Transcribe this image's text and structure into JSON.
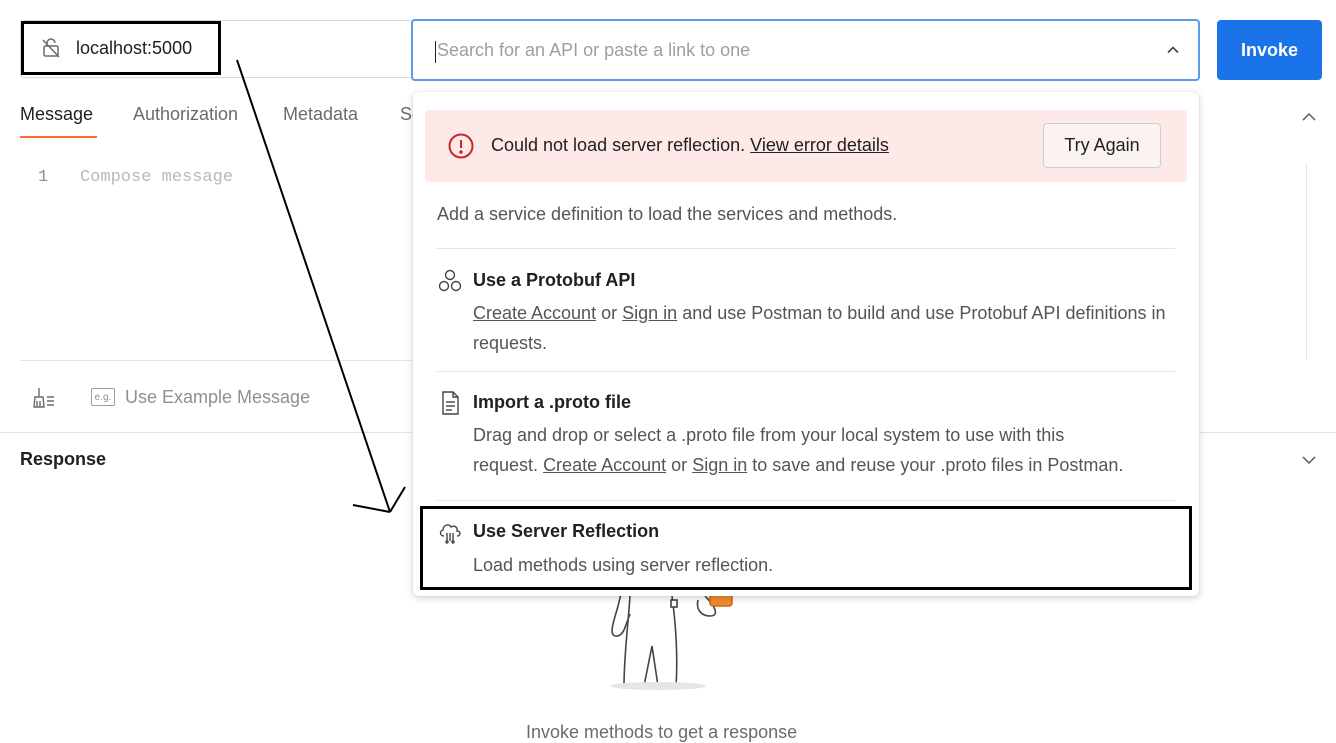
{
  "url_bar": {
    "url": "localhost:5000",
    "icon": "lock-off-icon"
  },
  "search": {
    "placeholder": "Search for an API or paste a link to one",
    "value": ""
  },
  "invoke_label": "Invoke",
  "tabs": [
    {
      "label": "Message",
      "active": true
    },
    {
      "label": "Authorization",
      "active": false
    },
    {
      "label": "Metadata",
      "active": false
    },
    {
      "label": "Se",
      "active": false
    }
  ],
  "editor": {
    "line_number": "1",
    "placeholder": "Compose message"
  },
  "toolbar": {
    "beautify_icon": "broom-icon",
    "example_badge": "e.g.",
    "example_label": "Use Example Message"
  },
  "response": {
    "title": "Response",
    "empty_message": "Invoke methods to get a response"
  },
  "dropdown": {
    "alert": {
      "message": "Could not load server reflection.",
      "link": "View error details",
      "button": "Try Again"
    },
    "hint": "Add a service definition to load the services and methods.",
    "options": [
      {
        "title": "Use a Protobuf API",
        "icon": "protobuf-icon",
        "link1": "Create Account",
        "or": "or",
        "link2": "Sign in",
        "rest": "and use Postman to build and use Protobuf API definitions in requests."
      },
      {
        "title": "Import a .proto file",
        "icon": "file-icon",
        "line1": "Drag and drop or select a .proto file from your local system to use with this",
        "pre": "request.",
        "link1": "Create Account",
        "or": "or",
        "link2": "Sign in",
        "rest": "to save and reuse your .proto files in Postman."
      },
      {
        "title": "Use Server Reflection",
        "icon": "cloud-reflection-icon",
        "desc": "Load methods using server reflection."
      }
    ]
  },
  "colors": {
    "accent": "#1a73e8",
    "tab_underline": "#ff6c37",
    "alert_bg": "#fde9e7",
    "alert_icon": "#c62828"
  }
}
